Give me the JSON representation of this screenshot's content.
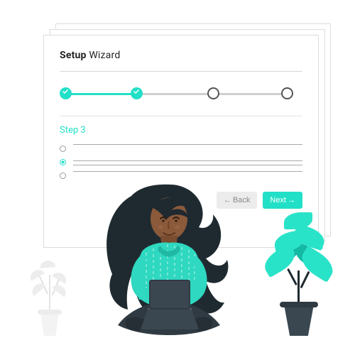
{
  "wizard": {
    "title_bold": "Setup",
    "title_rest": " Wizard",
    "steps_total": 4,
    "steps_done": 2,
    "step_label": "Step 3",
    "option_count": 3,
    "selected_option_index": 1,
    "back_label": "Back",
    "next_label": "Next"
  },
  "colors": {
    "accent": "#22e0c7",
    "panel_border": "#dcdcdc",
    "muted_btn": "#ececec"
  }
}
